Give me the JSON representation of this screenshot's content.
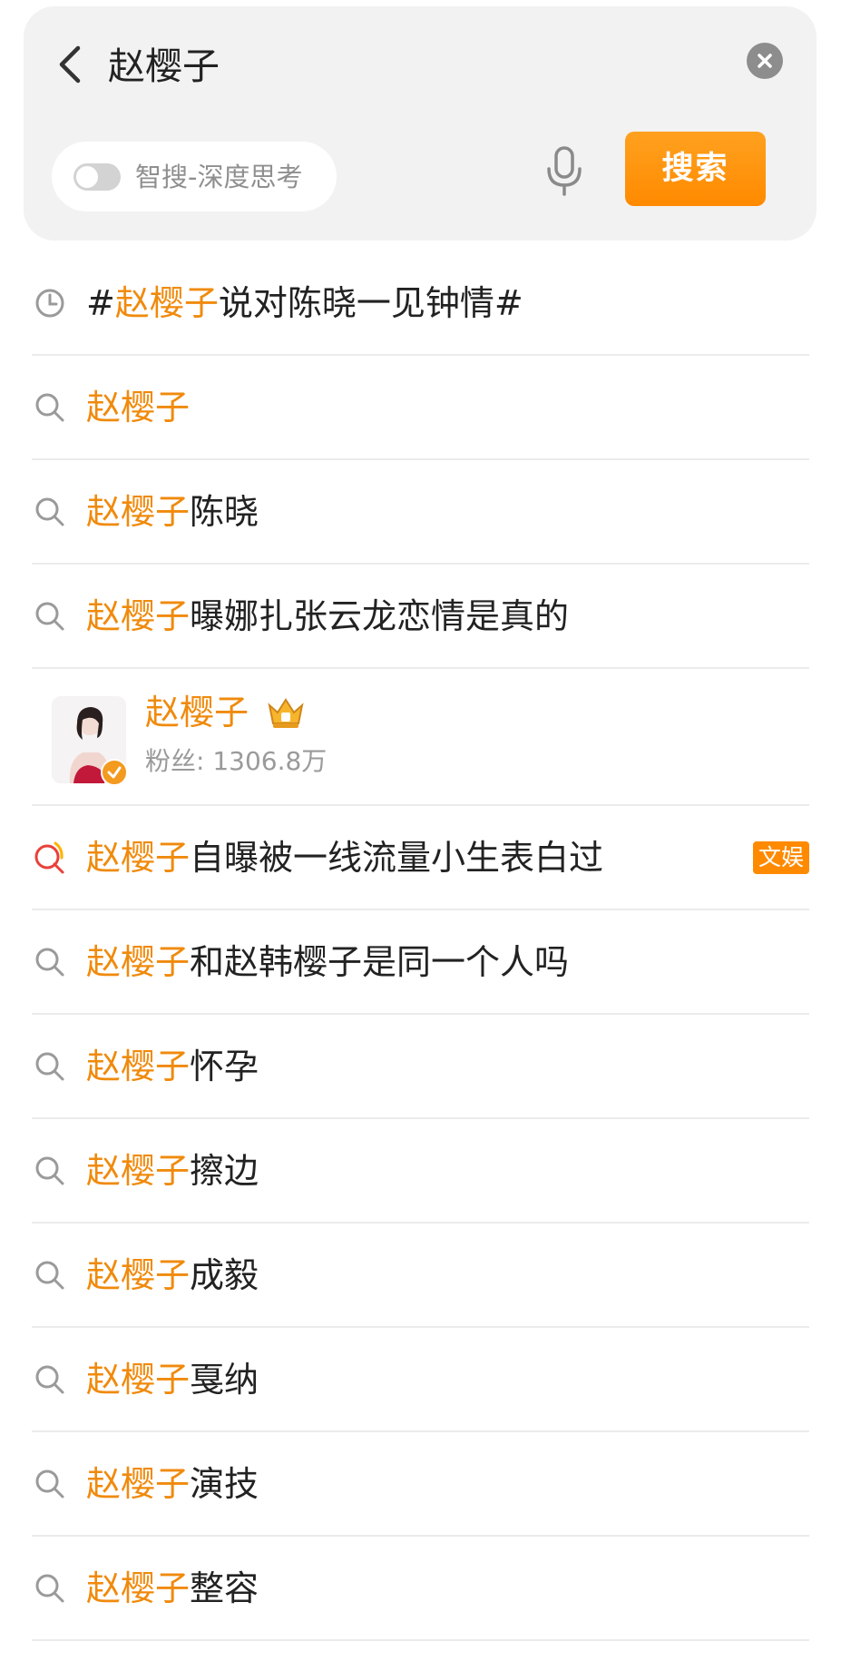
{
  "search": {
    "query": "赵樱子",
    "smart_toggle_label": "智搜-深度思考",
    "smart_toggle_on": false,
    "button_label": "搜索"
  },
  "colors": {
    "accent": "#f08a0c",
    "button": "#ff8a00",
    "badge": "#ff8a00"
  },
  "suggestions": [
    {
      "icon": "history-clock-icon",
      "prefix": "#",
      "highlight": "赵樱子",
      "rest": "说对陈晓一见钟情#"
    },
    {
      "icon": "search-icon",
      "prefix": "",
      "highlight": "赵樱子",
      "rest": ""
    },
    {
      "icon": "search-icon",
      "prefix": "",
      "highlight": "赵樱子",
      "rest": "陈晓"
    },
    {
      "icon": "search-icon",
      "prefix": "",
      "highlight": "赵樱子",
      "rest": "曝娜扎张云龙恋情是真的"
    },
    {
      "type": "user",
      "name": "赵樱子",
      "badge_icon": "crown-icon",
      "fans_label": "粉丝: 1306.8万"
    },
    {
      "icon": "hot-search-icon",
      "prefix": "",
      "highlight": "赵樱子",
      "rest": "自曝被一线流量小生表白过",
      "tag": "文娱"
    },
    {
      "icon": "search-icon",
      "prefix": "",
      "highlight": "赵樱子",
      "rest": "和赵韩樱子是同一个人吗"
    },
    {
      "icon": "search-icon",
      "prefix": "",
      "highlight": "赵樱子",
      "rest": "怀孕"
    },
    {
      "icon": "search-icon",
      "prefix": "",
      "highlight": "赵樱子",
      "rest": "擦边"
    },
    {
      "icon": "search-icon",
      "prefix": "",
      "highlight": "赵樱子",
      "rest": "成毅"
    },
    {
      "icon": "search-icon",
      "prefix": "",
      "highlight": "赵樱子",
      "rest": "戛纳"
    },
    {
      "icon": "search-icon",
      "prefix": "",
      "highlight": "赵樱子",
      "rest": "演技"
    },
    {
      "icon": "search-icon",
      "prefix": "",
      "highlight": "赵樱子",
      "rest": "整容"
    }
  ]
}
